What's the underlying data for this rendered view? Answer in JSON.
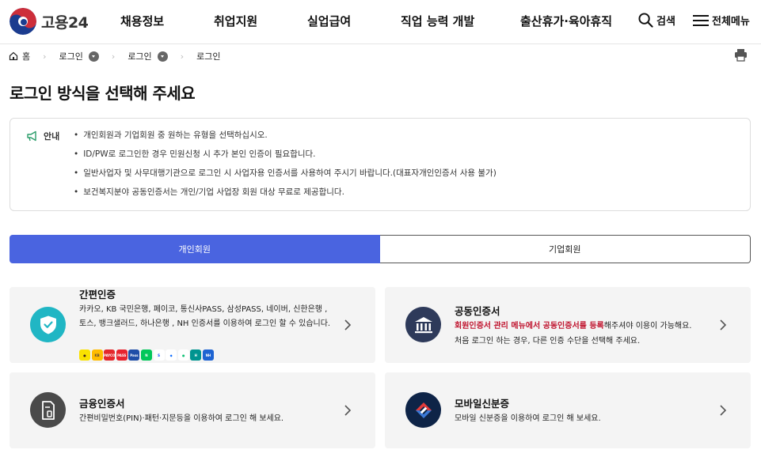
{
  "header": {
    "logo_text": "고용24",
    "nav": [
      "채용정보",
      "취업지원",
      "실업급여",
      "직업 능력 개발",
      "출산휴가·육아휴직"
    ],
    "search_label": "검색",
    "menu_label": "전체메뉴"
  },
  "breadcrumb": {
    "home": "홈",
    "items": [
      "로그인",
      "로그인",
      "로그인"
    ]
  },
  "page_title": "로그인 방식을 선택해 주세요",
  "notice": {
    "label": "안내",
    "items": [
      "개인회원과 기업회원 중 원하는 유형을 선택하십시오.",
      "ID/PW로 로그인한 경우 민원신청 시 추가 본인 인증이 필요합니다.",
      "일반사업자 및 사무대행기관으로 로그인 시 사업자용 인증서를 사용하여 주시기 바랍니다.(대표자개인인증서 사용 불가)",
      "보건복지분야 공동인증서는 개인/기업 사업장 회원 대상 무료로 제공합니다."
    ]
  },
  "tabs": [
    {
      "label": "개인회원",
      "active": true
    },
    {
      "label": "기업회원",
      "active": false
    }
  ],
  "cards": {
    "simple": {
      "title": "간편인증",
      "desc": "카카오, KB 국민은행, 페이코, 통신사PASS, 삼성PASS, 네이버, 신한은행 , 토스, 뱅크샐러드, 하나은행 , NH 인증서를 이용하여 로그인 할 수 있습니다.",
      "icon": "shield-check-icon",
      "banks": [
        {
          "name": "kakao",
          "text": "●",
          "color": "#fae100",
          "fg": "#3c1e1e"
        },
        {
          "name": "kb",
          "text": "KB",
          "color": "#ffbc00",
          "fg": "#5a4a3a"
        },
        {
          "name": "payco",
          "text": "PAYCO",
          "color": "#e4282c",
          "fg": "#fff"
        },
        {
          "name": "pass",
          "text": "PASS",
          "color": "#e8242f",
          "fg": "#fff"
        },
        {
          "name": "samsung-pass",
          "text": "Pass",
          "color": "#1f4ea8",
          "fg": "#fff"
        },
        {
          "name": "naver",
          "text": "N",
          "color": "#03c75a",
          "fg": "#fff"
        },
        {
          "name": "shinhan",
          "text": "S",
          "color": "#ffffff",
          "fg": "#0046ff"
        },
        {
          "name": "toss",
          "text": "◆",
          "color": "#ffffff",
          "fg": "#0064ff"
        },
        {
          "name": "banksalad",
          "text": "●",
          "color": "#ffffff",
          "fg": "#11c276"
        },
        {
          "name": "hana",
          "text": "H",
          "color": "#009490",
          "fg": "#fff"
        },
        {
          "name": "nh",
          "text": "NH",
          "color": "#1e64d2",
          "fg": "#fff"
        }
      ]
    },
    "joint": {
      "title": "공동인증서",
      "desc_hl": "회원인증서 관리 메뉴에서 공동인증서를 등록",
      "desc_rest": "해주셔야 이용이 가능해요.",
      "desc2": "처음 로그인 하는 경우, 다른 인증 수단을 선택해 주세요.",
      "icon": "bank-building-icon"
    },
    "finance": {
      "title": "금융인증서",
      "desc": "간편비밀번호(PIN)·패턴·지문등을 이용하여 로그인 해 보세요.",
      "icon": "certificate-document-icon"
    },
    "mobile": {
      "title": "모바일신분증",
      "desc": "모바일 신분증을 이용하여 로그인 해 보세요.",
      "icon": "mobile-id-icon"
    }
  },
  "colors": {
    "accent": "#4a64e0",
    "teal": "#20b6c4",
    "highlight": "#c0152f",
    "dark_icon": "#4a4a4a",
    "navy_icon": "#2e3a5a"
  }
}
